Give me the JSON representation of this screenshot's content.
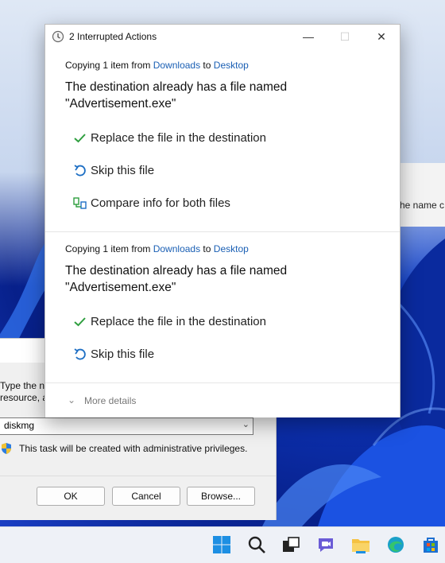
{
  "dialog": {
    "title": "2 Interrupted Actions",
    "controls": {
      "minimize": "—",
      "maximize": "☐",
      "close": "✕"
    },
    "items": [
      {
        "copy_prefix": "Copying 1 item from ",
        "source": "Downloads",
        "to": " to ",
        "destination": "Desktop",
        "headline_line1": "The destination already has a file named",
        "headline_line2": "\"Advertisement.exe\"",
        "options": {
          "replace": "Replace the file in the destination",
          "skip": "Skip this file",
          "compare": "Compare info for both files"
        }
      },
      {
        "copy_prefix": "Copying 1 item from ",
        "source": "Downloads",
        "to": " to ",
        "destination": "Desktop",
        "headline_line1": "The destination already has a file named",
        "headline_line2": "\"Advertisement.exe\"",
        "options": {
          "replace": "Replace the file in the destination",
          "skip": "Skip this file"
        }
      }
    ],
    "more_details": "More details"
  },
  "background_window": {
    "text": "he name c"
  },
  "run_dialog": {
    "description_line1": "Type the na",
    "description_line2": "resource, a",
    "input_value": "diskmg",
    "admin_note": "This task will be created with administrative privileges.",
    "ok": "OK",
    "cancel": "Cancel",
    "browse": "Browse..."
  },
  "taskbar": {
    "icons": [
      "windows-start-icon",
      "search-icon",
      "task-view-icon",
      "chat-icon",
      "file-explorer-icon",
      "edge-browser-icon",
      "store-icon"
    ]
  },
  "colors": {
    "link": "#1a5fb4",
    "check_green": "#2e9e3e",
    "skip_blue": "#1e6fc4"
  }
}
